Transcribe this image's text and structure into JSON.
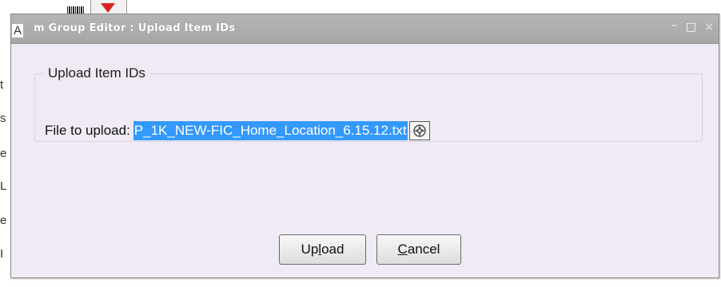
{
  "dialog": {
    "title": "m Group Editor : Upload Item IDs",
    "controls": {
      "minimize": "–",
      "maximize": "□",
      "close": "×"
    }
  },
  "background": {
    "label_a": "A",
    "side_letters": [
      "t",
      "s",
      "e",
      "L",
      "e",
      "I"
    ]
  },
  "group": {
    "legend": "Upload Item IDs",
    "file_label": "File to upload:",
    "file_value": "P_1K_NEW-FIC_Home_Location_6.15.12.txt"
  },
  "buttons": {
    "upload_pre": "Up",
    "upload_mnemonic": "l",
    "upload_post": "oad",
    "cancel_mnemonic": "C",
    "cancel_post": "ancel"
  }
}
